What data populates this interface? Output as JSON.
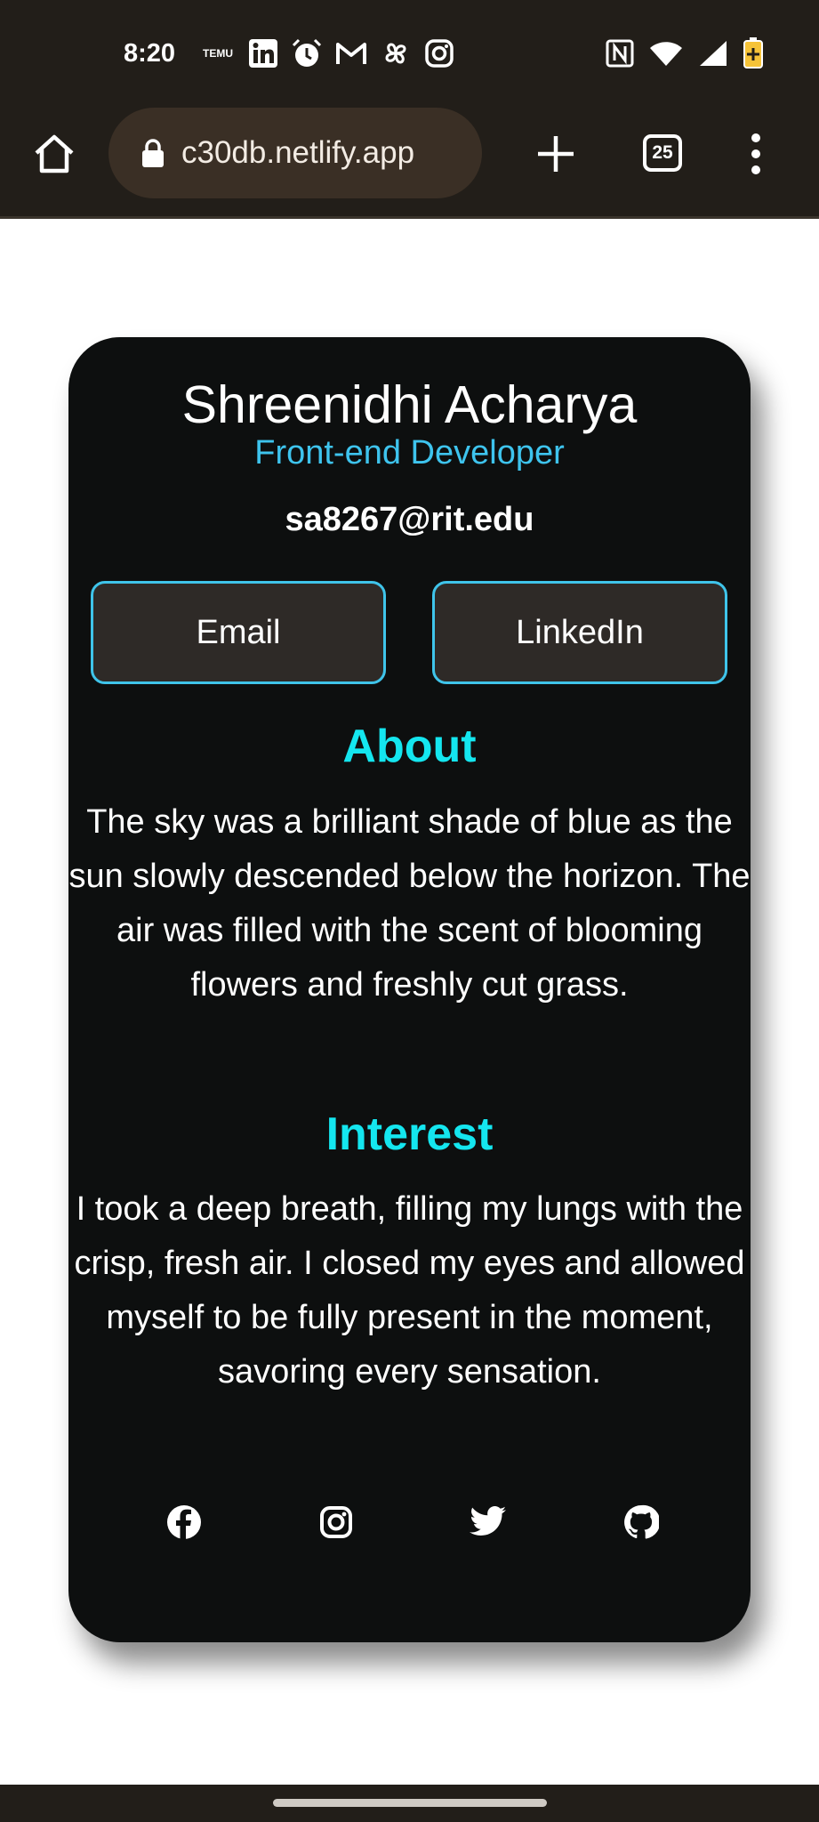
{
  "status_bar": {
    "time": "8:20",
    "left_icons": [
      "temu-icon",
      "linkedin-icon",
      "alarm-icon",
      "gmail-icon",
      "pinwheel-icon",
      "instagram-icon"
    ],
    "temu_label": "TEMU",
    "right_icons": [
      "nfc-icon",
      "wifi-icon",
      "signal-icon",
      "battery-icon"
    ]
  },
  "browser": {
    "url": "c30db.netlify.app",
    "tab_count": "25"
  },
  "profile": {
    "name": "Shreenidhi Acharya",
    "role": "Front-end Developer",
    "email": "sa8267@rit.edu",
    "buttons": {
      "email": "Email",
      "linkedin": "LinkedIn"
    },
    "about": {
      "title": "About",
      "text": "The sky was a brilliant shade of blue as the sun slowly descended below the horizon. The air was filled with the scent of blooming flowers and freshly cut grass."
    },
    "interest": {
      "title": "Interest",
      "text": "I took a deep breath, filling my lungs with the crisp, fresh air. I closed my eyes and allowed myself to be fully present in the moment, savoring every sensation."
    },
    "social_icons": [
      "facebook-icon",
      "instagram-icon",
      "twitter-icon",
      "github-icon"
    ]
  },
  "colors": {
    "accent_cyan": "#14e6ef",
    "role_blue": "#3ec4ee",
    "card_bg": "#0d0f0f",
    "chrome_bg": "#221e19"
  }
}
